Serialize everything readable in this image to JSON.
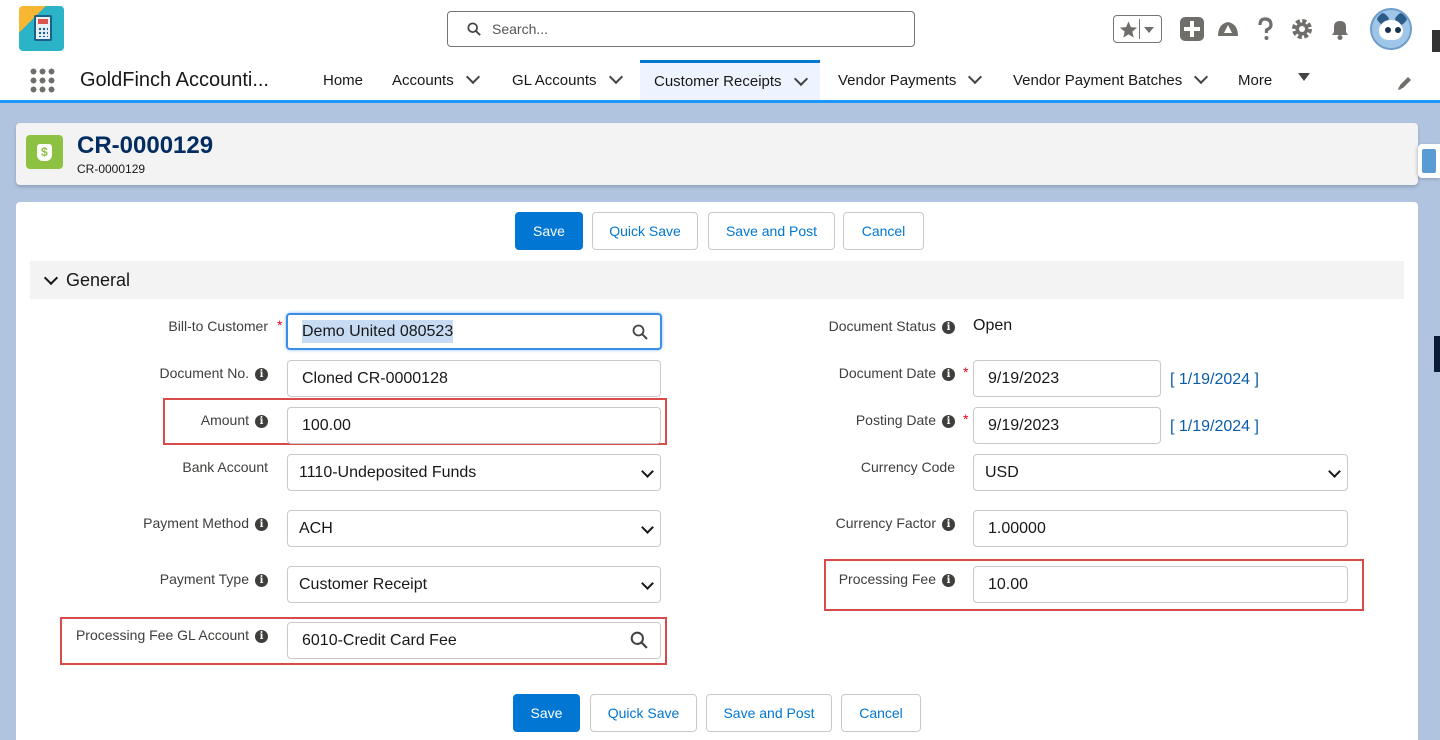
{
  "header": {
    "logo_text": "GoldFinch",
    "search_placeholder": "Search..."
  },
  "nav": {
    "app_name": "GoldFinch Accounti...",
    "items": [
      {
        "label": "Home"
      },
      {
        "label": "Accounts"
      },
      {
        "label": "GL Accounts"
      },
      {
        "label": "Customer Receipts"
      },
      {
        "label": "Vendor Payments"
      },
      {
        "label": "Vendor Payment Batches"
      },
      {
        "label": "More"
      }
    ]
  },
  "record": {
    "title": "CR-0000129",
    "subtitle": "CR-0000129"
  },
  "actions": {
    "save": "Save",
    "quick_save": "Quick Save",
    "save_and_post": "Save and Post",
    "cancel": "Cancel"
  },
  "section": {
    "title": "General"
  },
  "left_fields": {
    "bill_to_customer": {
      "label": "Bill-to Customer",
      "value": "Demo United 080523"
    },
    "document_no": {
      "label": "Document No.",
      "value": "Cloned CR-0000128"
    },
    "amount": {
      "label": "Amount",
      "value": "100.00"
    },
    "bank_account": {
      "label": "Bank Account",
      "value": "1110-Undeposited Funds"
    },
    "payment_method": {
      "label": "Payment Method",
      "value": "ACH"
    },
    "payment_type": {
      "label": "Payment Type",
      "value": "Customer Receipt"
    },
    "processing_fee_gl_account": {
      "label": "Processing Fee GL Account",
      "value": "6010-Credit Card Fee"
    }
  },
  "right_fields": {
    "document_status": {
      "label": "Document Status",
      "value": "Open"
    },
    "document_date": {
      "label": "Document Date",
      "value": "9/19/2023",
      "link": "[ 1/19/2024 ]"
    },
    "posting_date": {
      "label": "Posting Date",
      "value": "9/19/2023",
      "link": "[ 1/19/2024 ]"
    },
    "currency_code": {
      "label": "Currency Code",
      "value": "USD"
    },
    "currency_factor": {
      "label": "Currency Factor",
      "value": "1.00000"
    },
    "processing_fee": {
      "label": "Processing Fee",
      "value": "10.00"
    }
  },
  "colors": {
    "brand_blue": "#0176d3",
    "highlight_red": "#d94b4b",
    "record_icon_green": "#8dc141"
  }
}
